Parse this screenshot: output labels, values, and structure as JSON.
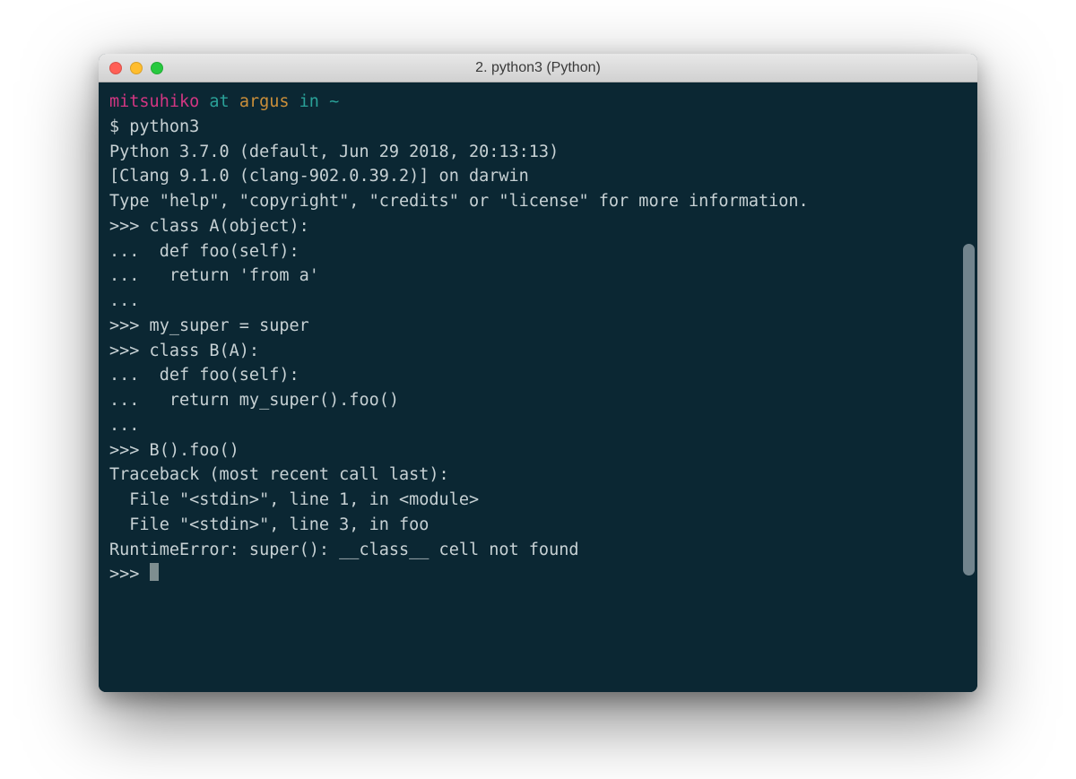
{
  "window": {
    "title": "2. python3 (Python)"
  },
  "prompt": {
    "user": "mitsuhiko",
    "at": " at ",
    "host": "argus",
    "in": " in ",
    "dir": "~"
  },
  "cmd_prefix": "$ ",
  "cmd": "python3",
  "banner": {
    "l1": "Python 3.7.0 (default, Jun 29 2018, 20:13:13)",
    "l2": "[Clang 9.1.0 (clang-902.0.39.2)] on darwin",
    "l3": "Type \"help\", \"copyright\", \"credits\" or \"license\" for more information."
  },
  "repl": {
    "p1": ">>> class A(object):",
    "p2": "...  def foo(self):",
    "p3": "...   return 'from a'",
    "p4": "...",
    "p5": ">>> my_super = super",
    "p6": ">>> class B(A):",
    "p7": "...  def foo(self):",
    "p8": "...   return my_super().foo()",
    "p9": "...",
    "p10": ">>> B().foo()"
  },
  "traceback": {
    "t1": "Traceback (most recent call last):",
    "t2": "  File \"<stdin>\", line 1, in <module>",
    "t3": "  File \"<stdin>\", line 3, in foo",
    "t4": "RuntimeError: super(): __class__ cell not found"
  },
  "final_prompt": ">>> "
}
